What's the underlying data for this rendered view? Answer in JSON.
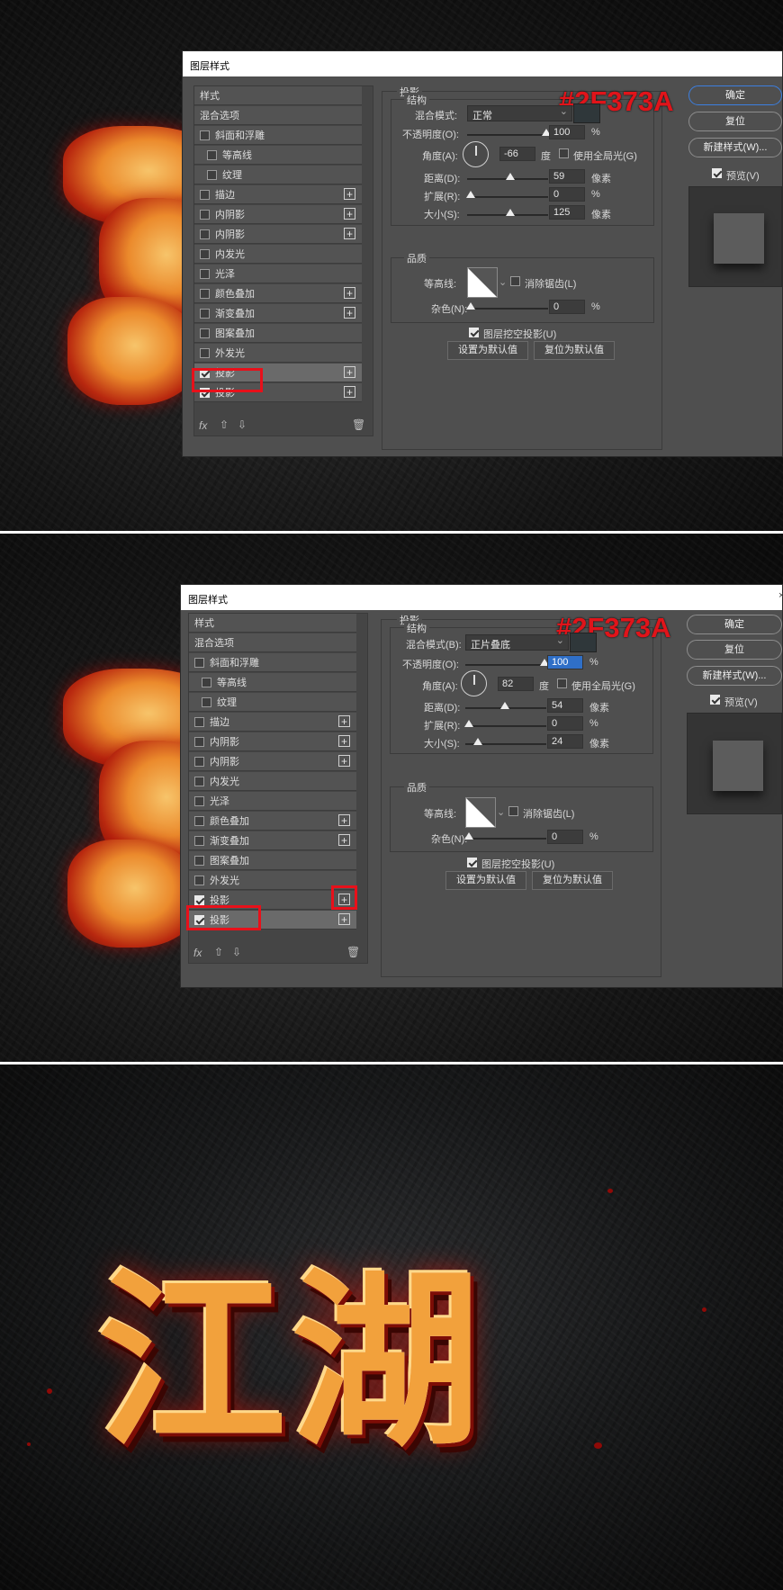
{
  "colors": {
    "accent_red": "#E0141A",
    "shadow_color": "#2F373A",
    "dialog_bg": "#4F4F4F"
  },
  "dialog_title": "图层样式",
  "hex_label": "#2F373A",
  "styles_list": {
    "header": "样式",
    "blend_options": "混合选项",
    "bevel": "斜面和浮雕",
    "contour": "等高线",
    "texture": "纹理",
    "stroke": "描边",
    "inner_shadow_1": "内阴影",
    "inner_shadow_2": "内阴影",
    "inner_glow": "内发光",
    "satin": "光泽",
    "color_overlay": "颜色叠加",
    "gradient_overlay": "渐变叠加",
    "pattern_overlay": "图案叠加",
    "outer_glow": "外发光",
    "drop_shadow_1": "投影",
    "drop_shadow_2": "投影"
  },
  "footer": {
    "fx": "fx",
    "up": "⇧",
    "down": "⇩",
    "trash": "🗑"
  },
  "section": {
    "title": "投影",
    "structure": "结构",
    "quality": "品质"
  },
  "labels": {
    "blend_mode_1": "混合模式:",
    "blend_mode_2": "混合模式(B):",
    "opacity": "不透明度(O):",
    "angle": "角度(A):",
    "deg": "度",
    "use_global": "使用全局光(G)",
    "distance": "距离(D):",
    "spread": "扩展(R):",
    "size": "大小(S):",
    "px": "像素",
    "pct": "%",
    "contour": "等高线:",
    "antialias": "消除锯齿(L)",
    "noise": "杂色(N):",
    "knockout": "图层挖空投影(U)",
    "set_default": "设置为默认值",
    "reset_default": "复位为默认值"
  },
  "buttons": {
    "ok": "确定",
    "reset": "复位",
    "new_style_1": "新建样式(W)...",
    "new_style_2": "新建样式(W)...",
    "preview": "预览(V)"
  },
  "dialog1": {
    "blend_mode": "正常",
    "opacity": "100",
    "angle": "-66",
    "distance": "59",
    "spread": "0",
    "size": "125",
    "noise": "0"
  },
  "dialog2": {
    "blend_mode": "正片叠底",
    "opacity": "100",
    "angle": "82",
    "distance": "54",
    "spread": "0",
    "size": "24",
    "noise": "0"
  },
  "result_text": "江湖"
}
